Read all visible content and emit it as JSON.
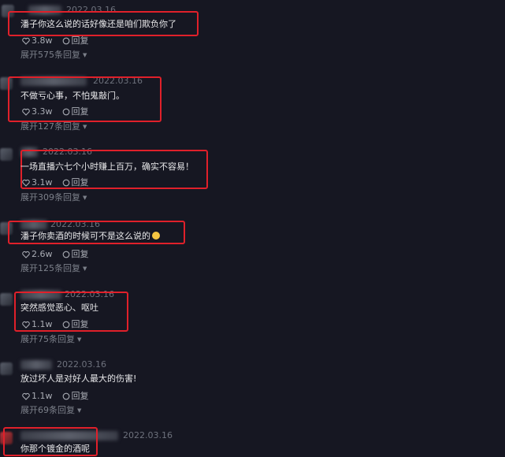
{
  "colors": {
    "background": "#161722",
    "highlight": "#e0202a",
    "date": "#6d717c",
    "text": "#e8e8ea"
  },
  "comments": [
    {
      "date": "2022.03.16",
      "text": "潘子你这么说的话好像还是咱们欺负你了",
      "likes": "3.8w",
      "reply": "回复",
      "expand": "展开575条回复"
    },
    {
      "date": "2022.03.16",
      "text": "不做亏心事，不怕鬼敲门。",
      "likes": "3.3w",
      "reply": "回复",
      "expand": "展开127条回复"
    },
    {
      "date": "2022.03.16",
      "text": "一场直播六七个小时赚上百万，确实不容易！",
      "likes": "3.1w",
      "reply": "回复",
      "expand": "展开309条回复"
    },
    {
      "date": "2022.03.16",
      "text": "潘子你卖酒的时候可不是这么说的",
      "emoji": "grimace-emoji",
      "likes": "2.6w",
      "reply": "回复",
      "expand": "展开125条回复"
    },
    {
      "date": "2022.03.16",
      "text": "突然感觉恶心、呕吐",
      "likes": "1.1w",
      "reply": "回复",
      "expand": "展开75条回复"
    },
    {
      "date": "2022.03.16",
      "text": "放过坏人是对好人最大的伤害!",
      "likes": "1.1w",
      "reply": "回复",
      "expand": "展开69条回复"
    },
    {
      "date": "2022.03.16",
      "text": "你那个镀金的酒呢"
    }
  ],
  "icons": {
    "like": "heart-icon",
    "reply": "comment-bubble-icon",
    "expand": "caret-down-icon"
  }
}
